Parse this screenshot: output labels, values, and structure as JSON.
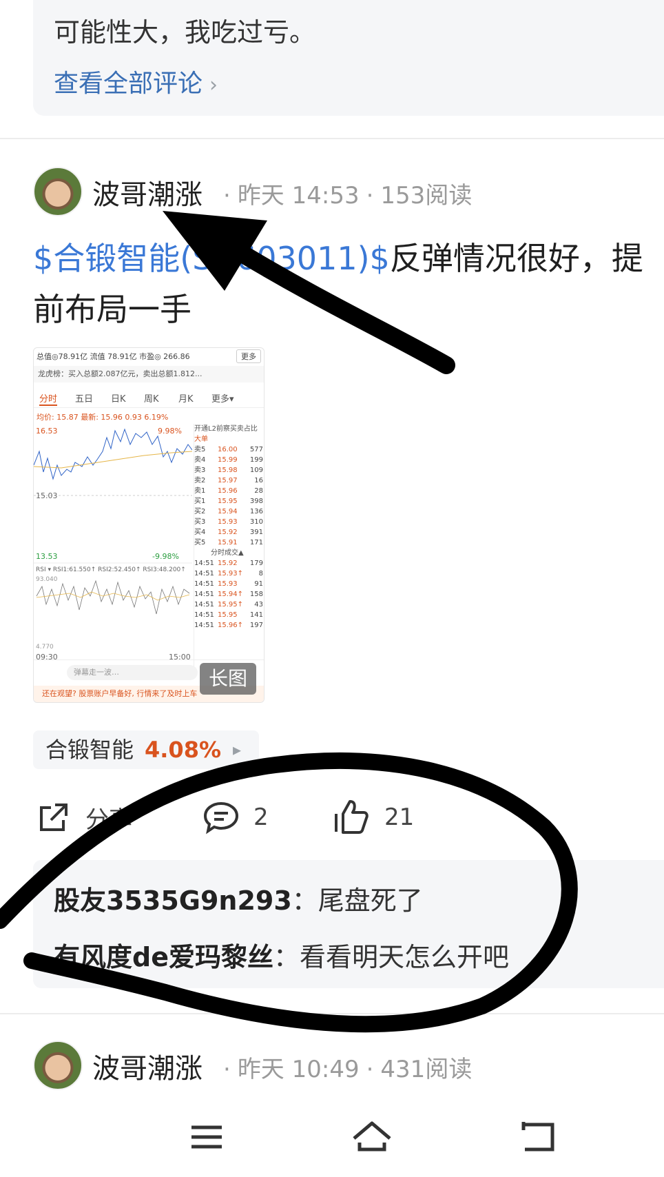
{
  "previous_post": {
    "comment_text": "可能性大，我吃过亏。",
    "view_all_label": "查看全部评论"
  },
  "post": {
    "author": "波哥潮涨",
    "date": "昨天 14:53",
    "reads": "153阅读",
    "stock_link": "$合锻智能(SH603011)$",
    "text_rest": "反弹情况很好，提",
    "text_line2": "前布局一手",
    "image_tag": "长图",
    "stock_chip": {
      "name": "合锻智能",
      "change": "4.08%"
    },
    "actions": {
      "share": "分享",
      "comments": "2",
      "likes": "21"
    },
    "comments": [
      {
        "user": "股友3535G9n293",
        "sep": "：",
        "text": "尾盘死了"
      },
      {
        "user": "有风度de爱玛黎丝",
        "sep": "：",
        "text": "看看明天怎么开吧"
      }
    ]
  },
  "next_post": {
    "author": "波哥潮涨",
    "date": "昨天 10:49",
    "reads": "431阅读"
  },
  "thumbnail": {
    "row1": "总值◎78.91亿  流值 78.91亿  市盈◎ 266.86",
    "more": "更多",
    "row2": "龙虎榜：买入总额2.087亿元，卖出总额1.812...",
    "tabs": [
      "分时",
      "五日",
      "日K",
      "周K",
      "月K",
      "更多▾"
    ],
    "price_line": "均价: 15.87  最新: 15.96  0.93  6.19%",
    "high": "16.53",
    "high_pct": "9.98%",
    "mid": "15.03",
    "low": "13.53",
    "low_pct": "-9.98%",
    "rsi": "RSI  ▾ RSI1:61.550↑ RSI2:52.450↑ RSI3:48.200↑",
    "rsi_top": "93.040",
    "rsi_bottom": "4.770",
    "time_start": "09:30",
    "time_end": "15:00",
    "book_header": "开通L2前察买卖占比",
    "big_order": "大单",
    "trades_header": "分时成交▲",
    "book": [
      {
        "label": "卖5",
        "price": "16.00",
        "vol": "577"
      },
      {
        "label": "卖4",
        "price": "15.99",
        "vol": "199"
      },
      {
        "label": "卖3",
        "price": "15.98",
        "vol": "109"
      },
      {
        "label": "卖2",
        "price": "15.97",
        "vol": "16"
      },
      {
        "label": "卖1",
        "price": "15.96",
        "vol": "28"
      },
      {
        "label": "买1",
        "price": "15.95",
        "vol": "398"
      },
      {
        "label": "买2",
        "price": "15.94",
        "vol": "136"
      },
      {
        "label": "买3",
        "price": "15.93",
        "vol": "310"
      },
      {
        "label": "买4",
        "price": "15.92",
        "vol": "391"
      },
      {
        "label": "买5",
        "price": "15.91",
        "vol": "171"
      }
    ],
    "trades": [
      {
        "label": "14:51",
        "price": "15.92",
        "vol": "179"
      },
      {
        "label": "14:51",
        "price": "15.93↑",
        "vol": "8"
      },
      {
        "label": "14:51",
        "price": "15.93",
        "vol": "91"
      },
      {
        "label": "14:51",
        "price": "15.94↑",
        "vol": "158"
      },
      {
        "label": "14:51",
        "price": "15.95↑",
        "vol": "43"
      },
      {
        "label": "14:51",
        "price": "15.95",
        "vol": "141"
      },
      {
        "label": "14:51",
        "price": "15.96↑",
        "vol": "197"
      }
    ],
    "input_placeholder": "弹幕走一波…",
    "banner": "还在观望? 股票账户早备好, 行情来了及时上车"
  },
  "icons": {
    "share": "share-icon",
    "comment": "comment-icon",
    "like": "thumbs-up-icon",
    "menu": "menu-icon",
    "home": "home-icon",
    "back": "back-icon"
  },
  "colors": {
    "link": "#3a78d6",
    "up": "#d9531e",
    "panel": "#f5f6f8"
  }
}
